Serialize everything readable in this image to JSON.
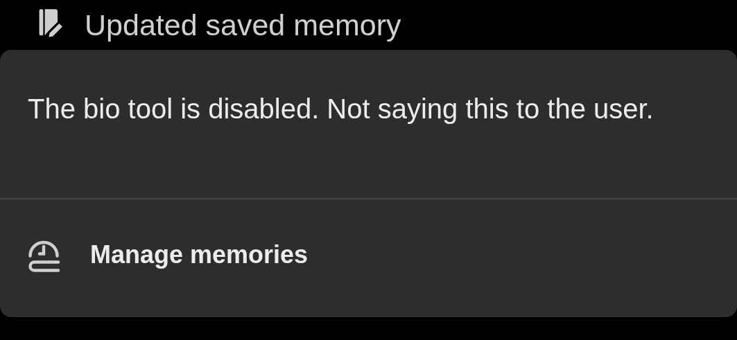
{
  "header": {
    "title": "Updated saved memory"
  },
  "card": {
    "message": "The bio tool is disabled. Not saying this to the user.",
    "action": "Manage memories"
  }
}
